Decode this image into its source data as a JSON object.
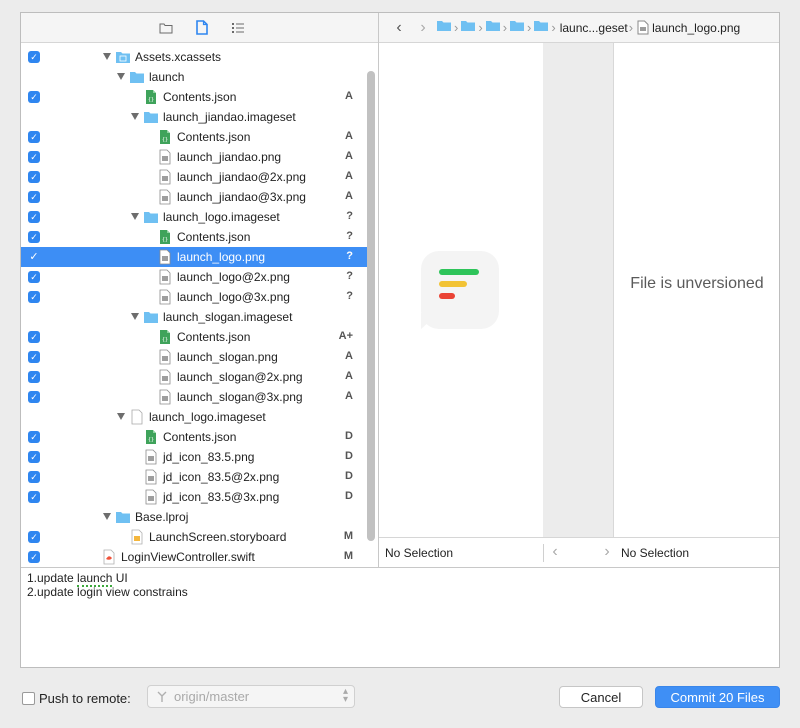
{
  "toolbar": {
    "icons": [
      "folder-icon",
      "file-icon",
      "list-icon"
    ]
  },
  "tree": [
    {
      "label": "Assets.xcassets",
      "status": "",
      "checked": true,
      "level": 1,
      "type": "folder-special",
      "expanded": true
    },
    {
      "label": "launch",
      "status": "",
      "checked": false,
      "level": 2,
      "type": "folder",
      "expanded": true
    },
    {
      "label": "Contents.json",
      "status": "A",
      "checked": true,
      "level": 3,
      "type": "json"
    },
    {
      "label": "launch_jiandao.imageset",
      "status": "",
      "checked": false,
      "level": 3,
      "type": "folder",
      "expanded": true
    },
    {
      "label": "Contents.json",
      "status": "A",
      "checked": true,
      "level": 4,
      "type": "json"
    },
    {
      "label": "launch_jiandao.png",
      "status": "A",
      "checked": true,
      "level": 4,
      "type": "png"
    },
    {
      "label": "launch_jiandao@2x.png",
      "status": "A",
      "checked": true,
      "level": 4,
      "type": "png"
    },
    {
      "label": "launch_jiandao@3x.png",
      "status": "A",
      "checked": true,
      "level": 4,
      "type": "png"
    },
    {
      "label": "launch_logo.imageset",
      "status": "?",
      "checked": true,
      "level": 3,
      "type": "folder",
      "expanded": true
    },
    {
      "label": "Contents.json",
      "status": "?",
      "checked": true,
      "level": 4,
      "type": "json"
    },
    {
      "label": "launch_logo.png",
      "status": "?",
      "checked": true,
      "level": 4,
      "type": "png",
      "selected": true
    },
    {
      "label": "launch_logo@2x.png",
      "status": "?",
      "checked": true,
      "level": 4,
      "type": "png"
    },
    {
      "label": "launch_logo@3x.png",
      "status": "?",
      "checked": true,
      "level": 4,
      "type": "png"
    },
    {
      "label": "launch_slogan.imageset",
      "status": "",
      "checked": false,
      "level": 3,
      "type": "folder",
      "expanded": true
    },
    {
      "label": "Contents.json",
      "status": "A+",
      "checked": true,
      "level": 4,
      "type": "json"
    },
    {
      "label": "launch_slogan.png",
      "status": "A",
      "checked": true,
      "level": 4,
      "type": "png"
    },
    {
      "label": "launch_slogan@2x.png",
      "status": "A",
      "checked": true,
      "level": 4,
      "type": "png"
    },
    {
      "label": "launch_slogan@3x.png",
      "status": "A",
      "checked": true,
      "level": 4,
      "type": "png"
    },
    {
      "label": "launch_logo.imageset",
      "status": "",
      "checked": false,
      "level": 2,
      "type": "doc",
      "expanded": true
    },
    {
      "label": "Contents.json",
      "status": "D",
      "checked": true,
      "level": 3,
      "type": "json"
    },
    {
      "label": "jd_icon_83.5.png",
      "status": "D",
      "checked": true,
      "level": 3,
      "type": "png"
    },
    {
      "label": "jd_icon_83.5@2x.png",
      "status": "D",
      "checked": true,
      "level": 3,
      "type": "png"
    },
    {
      "label": "jd_icon_83.5@3x.png",
      "status": "D",
      "checked": true,
      "level": 3,
      "type": "png"
    },
    {
      "label": "Base.lproj",
      "status": "",
      "checked": false,
      "level": 1,
      "type": "folder",
      "expanded": true
    },
    {
      "label": "LaunchScreen.storyboard",
      "status": "M",
      "checked": true,
      "level": 2,
      "type": "storyboard"
    },
    {
      "label": "LoginViewController.swift",
      "status": "M",
      "checked": true,
      "level": 0,
      "type": "swift"
    }
  ],
  "breadcrumb": {
    "folder_count": 5,
    "parent": "launc...geset",
    "file": "launch_logo.png"
  },
  "compare": {
    "unversioned_text": "File is unversioned",
    "left_selection": "No Selection",
    "right_selection": "No Selection"
  },
  "commit_message": {
    "line1_prefix": "1.update ",
    "line1_word": "launch",
    "line1_suffix": " UI",
    "line2": "2.update login view constrains"
  },
  "footer": {
    "push_label": "Push to remote:",
    "remote_value": "origin/master",
    "cancel_label": "Cancel",
    "commit_label": "Commit 20 Files"
  },
  "colors": {
    "accent": "#3f8ff5",
    "selected_row": "#3d8ef5",
    "folder": "#6fc0f2",
    "bar_green": "#2ec45a",
    "bar_yellow": "#f2c335",
    "bar_red": "#ea4335"
  }
}
